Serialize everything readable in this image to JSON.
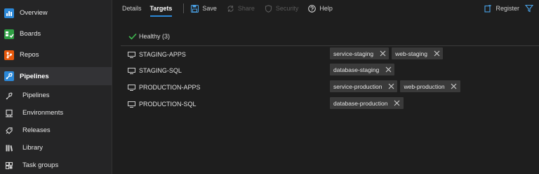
{
  "sidebar": {
    "items": [
      {
        "label": "Overview",
        "icon": "overview-icon"
      },
      {
        "label": "Boards",
        "icon": "boards-icon"
      },
      {
        "label": "Repos",
        "icon": "repos-icon"
      },
      {
        "label": "Pipelines",
        "icon": "pipelines-icon"
      },
      {
        "label": "Pipelines",
        "icon": "pipelines-sub-icon"
      },
      {
        "label": "Environments",
        "icon": "environments-icon"
      },
      {
        "label": "Releases",
        "icon": "releases-icon"
      },
      {
        "label": "Library",
        "icon": "library-icon"
      },
      {
        "label": "Task groups",
        "icon": "task-groups-icon"
      }
    ]
  },
  "toolbar": {
    "tabs": [
      {
        "label": "Details"
      },
      {
        "label": "Targets"
      }
    ],
    "save_label": "Save",
    "share_label": "Share",
    "security_label": "Security",
    "help_label": "Help",
    "register_label": "Register"
  },
  "group": {
    "label": "Healthy (3)"
  },
  "targets": [
    {
      "name": "STAGING-APPS",
      "tags": [
        "service-staging",
        "web-staging"
      ]
    },
    {
      "name": "STAGING-SQL",
      "tags": [
        "database-staging"
      ]
    },
    {
      "name": "PRODUCTION-APPS",
      "tags": [
        "service-production",
        "web-production"
      ]
    },
    {
      "name": "PRODUCTION-SQL",
      "tags": [
        "database-production"
      ]
    }
  ],
  "colors": {
    "accent": "#2b88d8",
    "healthy": "#3fb950",
    "repos": "#e8590c",
    "boards": "#2ea043",
    "pipelines": "#2b88d8"
  }
}
